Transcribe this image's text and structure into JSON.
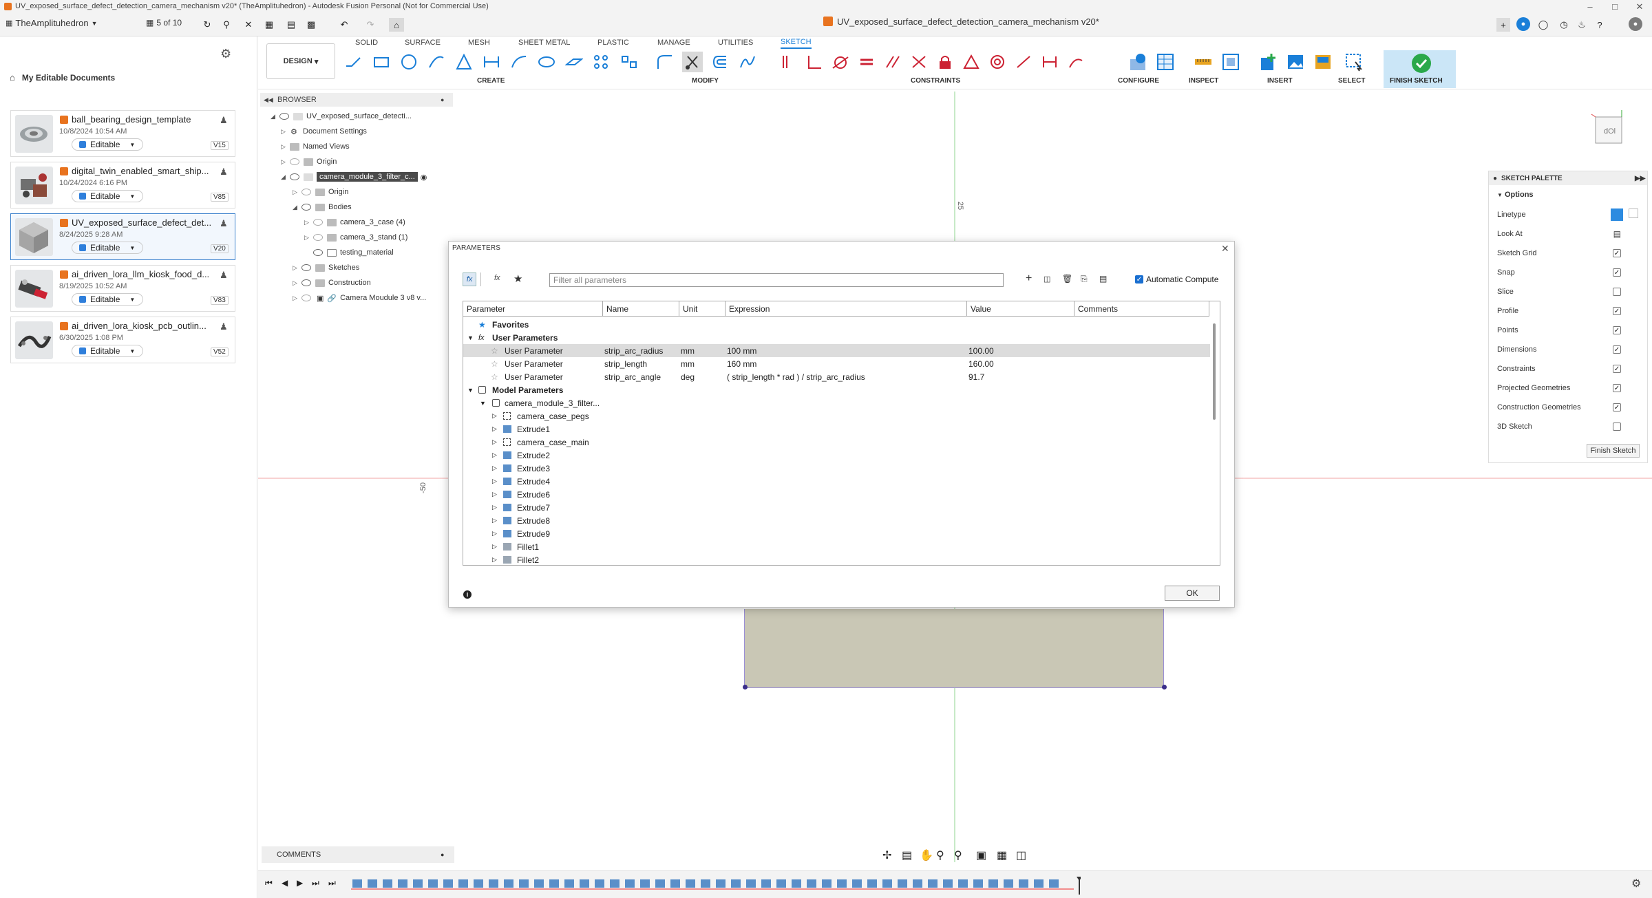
{
  "window": {
    "title": "UV_exposed_surface_defect_detection_camera_mechanism v20* (TheAmplituhedron) - Autodesk Fusion Personal (Not for Commercial Use)"
  },
  "appbar": {
    "team": "TheAmplituhedron",
    "jobs": "5 of 10",
    "doc_tab": "UV_exposed_surface_defect_detection_camera_mechanism v20*"
  },
  "data_panel": {
    "location": "My Editable Documents",
    "documents": [
      {
        "name": "ball_bearing_design_template",
        "date": "10/8/2024 10:54 AM",
        "status": "Editable",
        "version": "V15"
      },
      {
        "name": "digital_twin_enabled_smart_ship...",
        "date": "10/24/2024 6:16 PM",
        "status": "Editable",
        "version": "V85"
      },
      {
        "name": "UV_exposed_surface_defect_det...",
        "date": "8/24/2025 9:28 AM",
        "status": "Editable",
        "version": "V20"
      },
      {
        "name": "ai_driven_lora_llm_kiosk_food_d...",
        "date": "8/19/2025 10:52 AM",
        "status": "Editable",
        "version": "V83"
      },
      {
        "name": "ai_driven_lora_kiosk_pcb_outlin...",
        "date": "6/30/2025 1:08 PM",
        "status": "Editable",
        "version": "V52"
      }
    ]
  },
  "toolbar": {
    "design": "DESIGN",
    "tabs": [
      "SOLID",
      "SURFACE",
      "MESH",
      "SHEET METAL",
      "PLASTIC",
      "MANAGE",
      "UTILITIES",
      "SKETCH"
    ],
    "groups": {
      "create": "CREATE",
      "modify": "MODIFY",
      "constraints": "CONSTRAINTS",
      "configure": "CONFIGURE",
      "inspect": "INSPECT",
      "insert": "INSERT",
      "select": "SELECT",
      "finish": "FINISH SKETCH"
    }
  },
  "browser": {
    "title": "BROWSER",
    "items": [
      {
        "label": "UV_exposed_surface_detecti..."
      },
      {
        "label": "Document Settings"
      },
      {
        "label": "Named Views"
      },
      {
        "label": "Origin"
      },
      {
        "label": "camera_module_3_filter_c..."
      },
      {
        "label": "Origin"
      },
      {
        "label": "Bodies"
      },
      {
        "label": "camera_3_case (4)"
      },
      {
        "label": "camera_3_stand (1)"
      },
      {
        "label": "testing_material"
      },
      {
        "label": "Sketches"
      },
      {
        "label": "Construction"
      },
      {
        "label": "Camera Moudule 3 v8 v..."
      }
    ]
  },
  "canvas": {
    "dim_top": "25",
    "dim_left": "-50"
  },
  "palette": {
    "title": "SKETCH PALETTE",
    "section": "Options",
    "options": [
      {
        "label": "Linetype",
        "checked": null
      },
      {
        "label": "Look At",
        "checked": null
      },
      {
        "label": "Sketch Grid",
        "checked": true
      },
      {
        "label": "Snap",
        "checked": true
      },
      {
        "label": "Slice",
        "checked": false
      },
      {
        "label": "Profile",
        "checked": true
      },
      {
        "label": "Points",
        "checked": true
      },
      {
        "label": "Dimensions",
        "checked": true
      },
      {
        "label": "Constraints",
        "checked": true
      },
      {
        "label": "Projected Geometries",
        "checked": true
      },
      {
        "label": "Construction Geometries",
        "checked": true
      },
      {
        "label": "3D Sketch",
        "checked": false
      }
    ],
    "finish_label": "Finish Sketch"
  },
  "dialog": {
    "title": "PARAMETERS",
    "filter_placeholder": "Filter all parameters",
    "auto_compute": "Automatic Compute",
    "columns": [
      "Parameter",
      "Name",
      "Unit",
      "Expression",
      "Value",
      "Comments"
    ],
    "favorites": "Favorites",
    "user_params_label": "User Parameters",
    "user_params": [
      {
        "parameter": "User Parameter",
        "name": "strip_arc_radius",
        "unit": "mm",
        "expression": "100 mm",
        "value": "100.00"
      },
      {
        "parameter": "User Parameter",
        "name": "strip_length",
        "unit": "mm",
        "expression": "160 mm",
        "value": "160.00"
      },
      {
        "parameter": "User Parameter",
        "name": "strip_arc_angle",
        "unit": "deg",
        "expression": "( strip_length * rad ) / strip_arc_radius",
        "value": "91.7"
      }
    ],
    "model_params_label": "Model Parameters",
    "component": "camera_module_3_filter...",
    "features": [
      "camera_case_pegs",
      "Extrude1",
      "camera_case_main",
      "Extrude2",
      "Extrude3",
      "Extrude4",
      "Extrude6",
      "Extrude7",
      "Extrude8",
      "Extrude9",
      "Fillet1",
      "Fillet2"
    ],
    "ok": "OK"
  },
  "comments": {
    "label": "COMMENTS"
  }
}
